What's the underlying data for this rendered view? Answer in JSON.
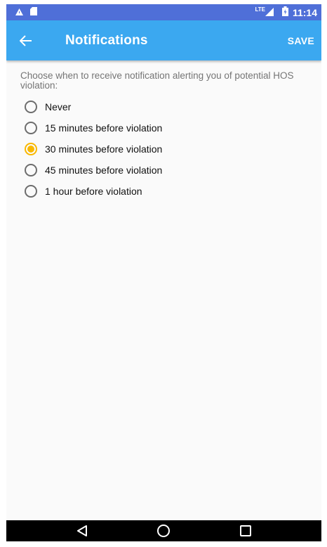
{
  "status_bar": {
    "network": "LTE",
    "time": "11:14"
  },
  "app_bar": {
    "title": "Notifications",
    "save_label": "SAVE"
  },
  "prompt": "Choose when to receive notification alerting you of potential HOS violation:",
  "options": [
    {
      "label": "Never",
      "selected": false
    },
    {
      "label": "15 minutes before violation",
      "selected": false
    },
    {
      "label": "30 minutes before violation",
      "selected": true
    },
    {
      "label": "45 minutes before violation",
      "selected": false
    },
    {
      "label": "1 hour before violation",
      "selected": false
    }
  ],
  "colors": {
    "status_bar": "#4f6fd8",
    "app_bar": "#3ba8f0",
    "radio_selected": "#f9b800",
    "radio_unselected": "#6d6d6d"
  },
  "icons": {
    "status_left": [
      "warning-icon",
      "sd-card-icon"
    ],
    "status_right": [
      "signal-icon",
      "battery-charging-icon"
    ],
    "nav": [
      "back-triangle-icon",
      "home-circle-icon",
      "recents-square-icon"
    ]
  }
}
